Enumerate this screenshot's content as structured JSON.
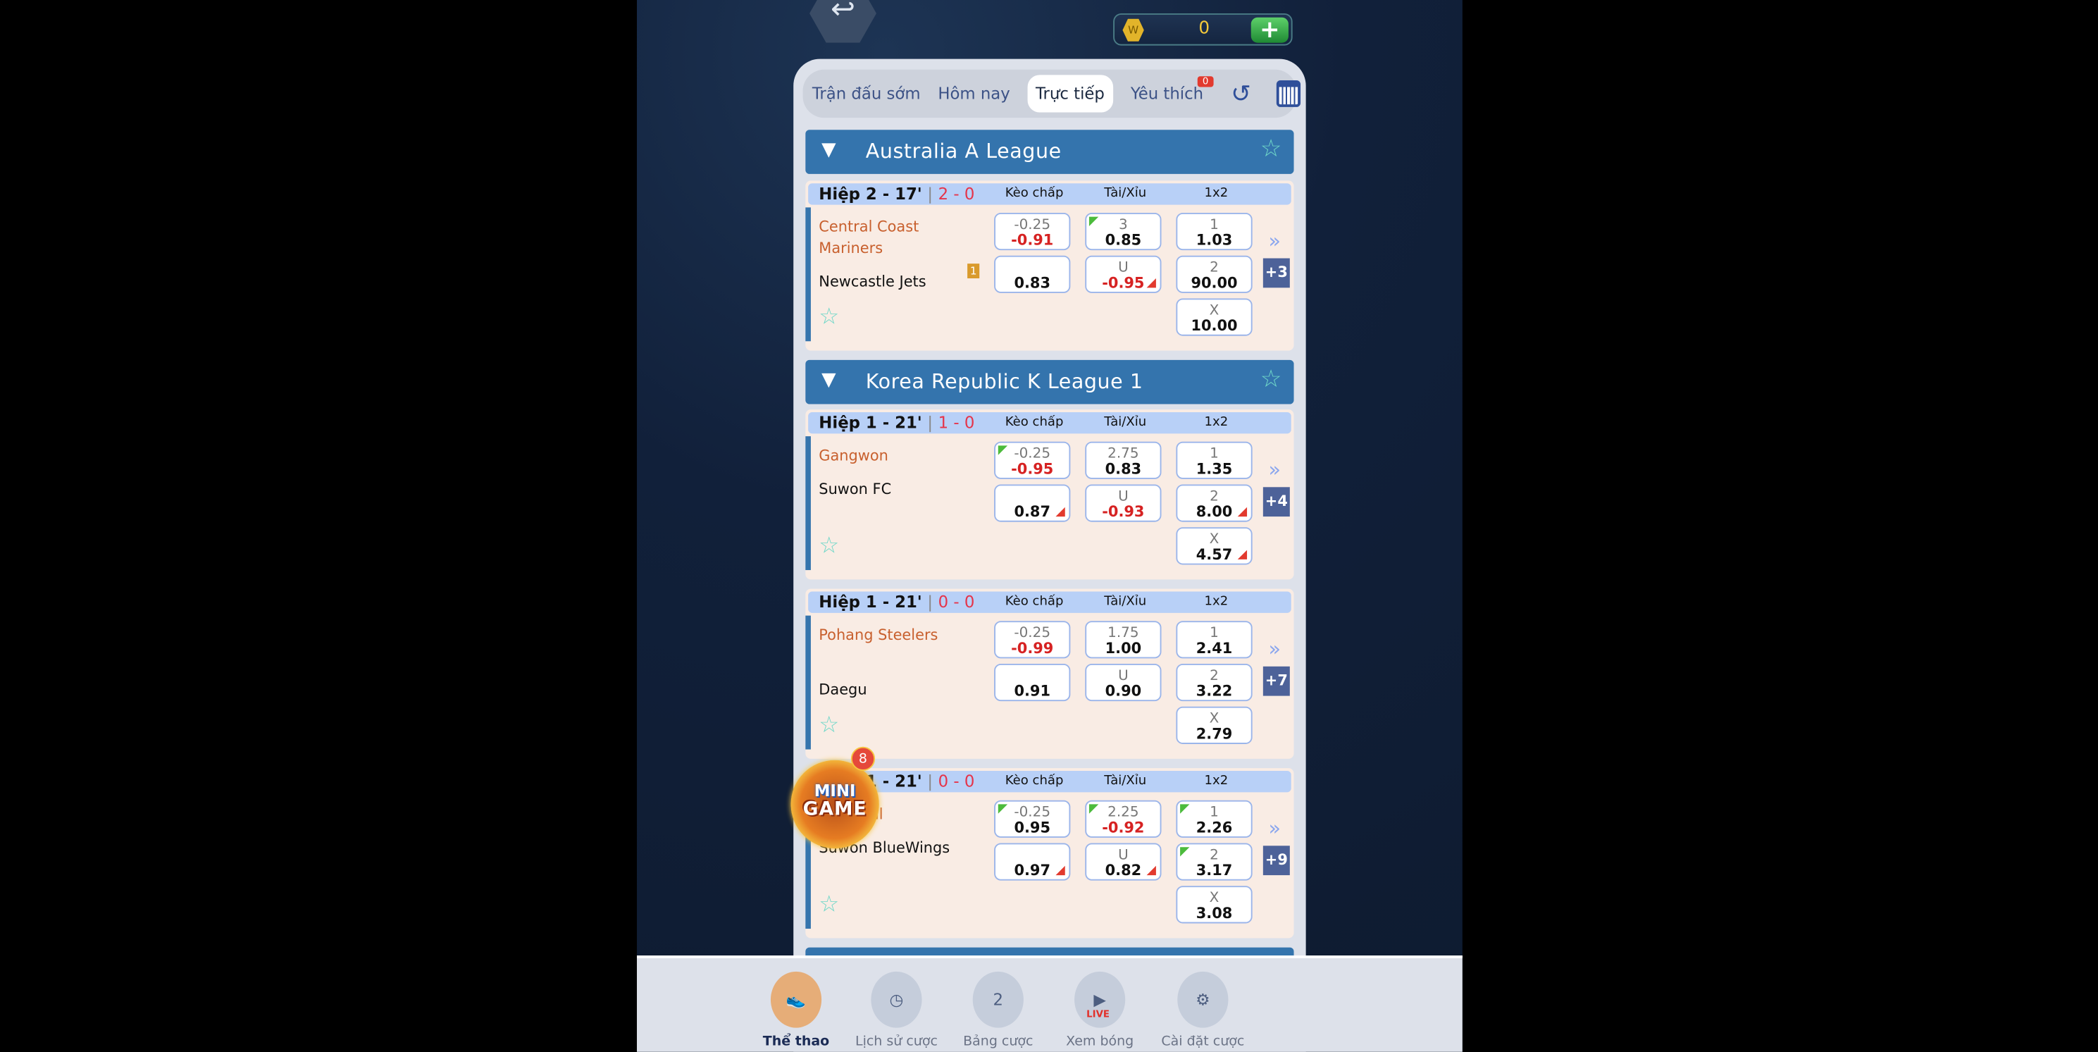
{
  "header": {
    "back_icon": "back-arrow-icon",
    "coin_balance": "0",
    "coin_icon": "coin-icon",
    "add_icon": "plus-icon"
  },
  "tabs": [
    {
      "label": "Trận đấu sớm"
    },
    {
      "label": "Hôm nay"
    },
    {
      "label": "Trực tiếp",
      "active": true
    },
    {
      "label": "Yêu thích",
      "badge": "0"
    }
  ],
  "column_headers": {
    "handicap": "Kèo chấp",
    "over_under": "Tài/Xỉu",
    "one_x_two": "1x2"
  },
  "leagues": [
    {
      "name": "Australia A League",
      "matches": [
        {
          "period": "Hiệp 2 - 17'",
          "score": "2 - 0",
          "home": "Central Coast Mariners",
          "away": "Newcastle Jets",
          "away_red_cards": "1",
          "handicap": [
            {
              "label": "-0.25",
              "value": "-0.91"
            },
            {
              "label": "",
              "value": "0.83"
            }
          ],
          "over_under": [
            {
              "label": "3",
              "value": "0.85",
              "trend": "up"
            },
            {
              "label": "U",
              "value": "-0.95",
              "trend": "down"
            }
          ],
          "one_x_two": [
            {
              "label": "1",
              "value": "1.03"
            },
            {
              "label": "2",
              "value": "90.00"
            },
            {
              "label": "X",
              "value": "10.00"
            }
          ],
          "more": "+3"
        }
      ]
    },
    {
      "name": "Korea Republic K League 1",
      "matches": [
        {
          "period": "Hiệp 1 - 21'",
          "score": "1 - 0",
          "home": "Gangwon",
          "away": "Suwon FC",
          "handicap": [
            {
              "label": "-0.25",
              "value": "-0.95",
              "trend": "up"
            },
            {
              "label": "",
              "value": "0.87",
              "trend": "down"
            }
          ],
          "over_under": [
            {
              "label": "2.75",
              "value": "0.83"
            },
            {
              "label": "U",
              "value": "-0.93"
            }
          ],
          "one_x_two": [
            {
              "label": "1",
              "value": "1.35"
            },
            {
              "label": "2",
              "value": "8.00",
              "trend": "down"
            },
            {
              "label": "X",
              "value": "4.57",
              "trend": "down"
            }
          ],
          "more": "+4"
        },
        {
          "period": "Hiệp 1 - 21'",
          "score": "0 - 0",
          "home": "Pohang Steelers",
          "away": "Daegu",
          "handicap": [
            {
              "label": "-0.25",
              "value": "-0.99"
            },
            {
              "label": "",
              "value": "0.91"
            }
          ],
          "over_under": [
            {
              "label": "1.75",
              "value": "1.00"
            },
            {
              "label": "U",
              "value": "0.90"
            }
          ],
          "one_x_two": [
            {
              "label": "1",
              "value": "2.41"
            },
            {
              "label": "2",
              "value": "3.22"
            },
            {
              "label": "X",
              "value": "2.79"
            }
          ],
          "more": "+7"
        },
        {
          "period": "Hiệp 1 - 21'",
          "score": "0 - 0",
          "home": "FC Seoul",
          "away": "Suwon BlueWings",
          "handicap": [
            {
              "label": "-0.25",
              "value": "0.95",
              "trend": "up"
            },
            {
              "label": "",
              "value": "0.97",
              "trend": "down"
            }
          ],
          "over_under": [
            {
              "label": "2.25",
              "value": "-0.92",
              "trend": "up"
            },
            {
              "label": "U",
              "value": "0.82",
              "trend": "down"
            }
          ],
          "one_x_two": [
            {
              "label": "1",
              "value": "2.26",
              "trend": "up"
            },
            {
              "label": "2",
              "value": "3.17",
              "trend": "up"
            },
            {
              "label": "X",
              "value": "3.08"
            }
          ],
          "more": "+9"
        }
      ]
    }
  ],
  "minigame": {
    "line1": "MINI",
    "line2": "GAME",
    "badge": "8"
  },
  "bottom_nav": [
    {
      "label": "Thể thao",
      "icon": "soccer-shoe-icon",
      "active": true
    },
    {
      "label": "Lịch sử cược",
      "icon": "history-clock-icon"
    },
    {
      "label": "Bảng cược",
      "icon": "leaderboard-icon"
    },
    {
      "label": "Xem bóng",
      "icon": "live-video-icon",
      "icon_text": "LIVE"
    },
    {
      "label": "Cài đặt cược",
      "icon": "settings-gear-icon"
    }
  ],
  "colors": {
    "league_header": "#3474ad",
    "match_bg": "#f9ece4",
    "home_team": "#c8602e",
    "score": "#e5344a",
    "negative_odds": "#d62222",
    "active_nav": "#e6ad78"
  }
}
